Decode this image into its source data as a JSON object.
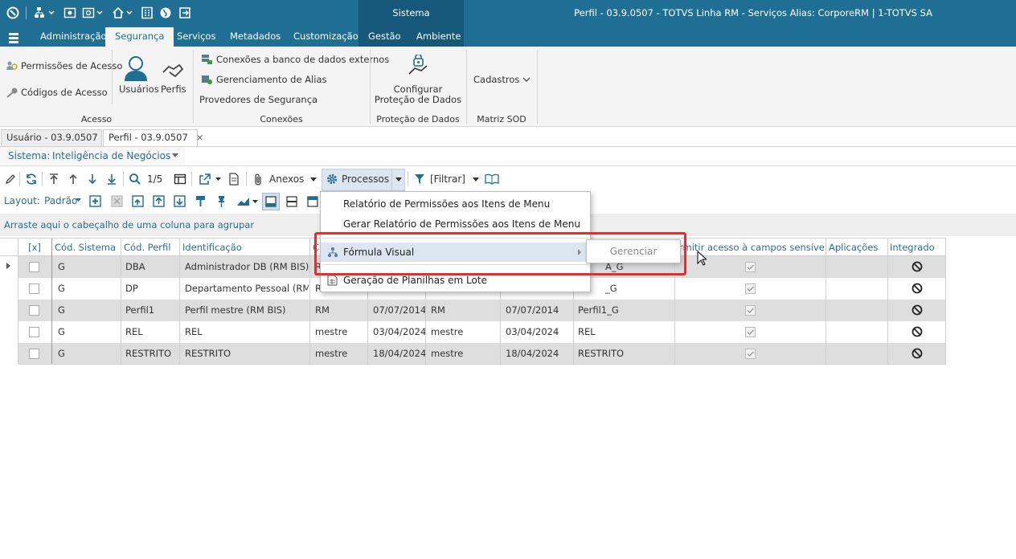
{
  "title_bar": {
    "text": "Perfil - 03.9.0507 - TOTVS Linha RM - Serviços  Alias: CorporeRM | 1-TOTVS SA",
    "context_tab": "Sistema"
  },
  "ribbon_tabs": [
    "Administração",
    "Segurança",
    "Serviços",
    "Metadados",
    "Customização",
    "Gestão",
    "Ambiente"
  ],
  "ribbon": {
    "acesso": {
      "permissoes": "Permissões de Acesso",
      "codigos": "Códigos de Acesso",
      "usuarios": "Usuários",
      "perfis": "Perfis",
      "group": "Acesso"
    },
    "conexoes": {
      "banco": "Conexões a banco de dados externos",
      "alias": "Gerenciamento de Alias",
      "provedores": "Provedores de Segurança",
      "group": "Conexões"
    },
    "protecao": {
      "line1": "Configurar",
      "line2": "Proteção de Dados",
      "group": "Proteção de Dados"
    },
    "sod": {
      "cadastros": "Cadastros",
      "group": "Matriz SOD"
    }
  },
  "doc_tabs": [
    "Usuário - 03.9.0507",
    "Perfil - 03.9.0507"
  ],
  "sistema": {
    "label": "Sistema:",
    "value": "Inteligência de Negócios"
  },
  "toolbar": {
    "page": "1/5",
    "anexos": "Anexos",
    "processos": "Processos",
    "filtrar": "[Filtrar]"
  },
  "layout": {
    "label": "Layout:",
    "value": "Padrão"
  },
  "group_hint": "Arraste aqui o cabeçalho de uma coluna para agrupar",
  "columns": [
    "[x]",
    "Cód. Sistema",
    "Cód. Perfil",
    "Identificação",
    "C",
    "",
    "",
    "",
    "",
    "rmitir acesso à campos sensíveis",
    "Aplicações",
    "Integrado"
  ],
  "rows": [
    {
      "sistema": "G",
      "perfil": "DBA",
      "ident": "Administrador DB (RM BIS)",
      "c1": "R",
      "c2": "",
      "c3": "",
      "c4": "",
      "c5": "A_G"
    },
    {
      "sistema": "G",
      "perfil": "DP",
      "ident": "Departamento Pessoal (RM B...",
      "c1": "R",
      "c2": "",
      "c3": "",
      "c4": "",
      "c5": "_G"
    },
    {
      "sistema": "G",
      "perfil": "Perfil1",
      "ident": "Perfil mestre (RM BIS)",
      "c1": "RM",
      "c2": "07/07/2014",
      "c3": "RM",
      "c4": "07/07/2014",
      "c5": "Perfil1_G"
    },
    {
      "sistema": "G",
      "perfil": "REL",
      "ident": "REL",
      "c1": "mestre",
      "c2": "03/04/2024",
      "c3": "mestre",
      "c4": "03/04/2024",
      "c5": "REL"
    },
    {
      "sistema": "G",
      "perfil": "RESTRITO",
      "ident": "RESTRITO",
      "c1": "mestre",
      "c2": "18/04/2024",
      "c3": "mestre",
      "c4": "18/04/2024",
      "c5": "RESTRITO"
    }
  ],
  "menu": {
    "items": [
      "Relatório de Permissões aos Itens de Menu",
      "Gerar Relatório de Permissões aos Itens de Menu",
      "Fórmula Visual",
      "Geração de Planilhas em Lote"
    ],
    "submenu": "Gerenciar"
  },
  "colors": {
    "titlebar": "#1f6f95",
    "highlight": "#e03030",
    "header_text": "#2c6d90"
  }
}
